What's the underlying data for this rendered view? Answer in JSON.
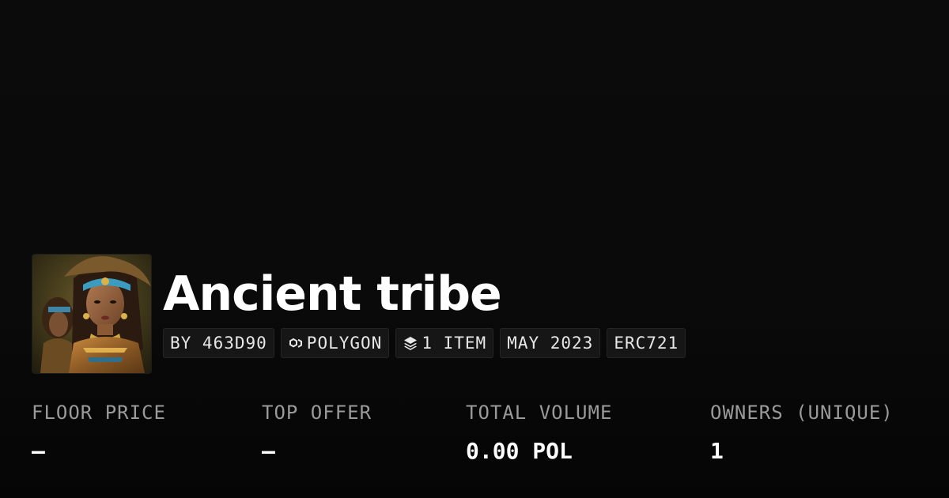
{
  "collection": {
    "title": "Ancient tribe",
    "avatar_icon": "collection-avatar-portrait"
  },
  "tags": {
    "creator": "BY 463D90",
    "chain": "POLYGON",
    "chain_icon": "polygon-chain-icon",
    "items": "1 ITEM",
    "items_icon": "layers-icon",
    "date": "MAY 2023",
    "standard": "ERC721"
  },
  "stats": {
    "floor_price": {
      "label": "FLOOR PRICE",
      "value": "–"
    },
    "top_offer": {
      "label": "TOP OFFER",
      "value": "–"
    },
    "total_volume": {
      "label": "TOTAL VOLUME",
      "value": "0.00 POL"
    },
    "owners": {
      "label": "OWNERS (UNIQUE)",
      "value": "1"
    }
  },
  "colors": {
    "background": "#0a0a0a",
    "text_primary": "#ffffff",
    "text_secondary": "#9a9a9a",
    "tag_background": "#161616"
  }
}
